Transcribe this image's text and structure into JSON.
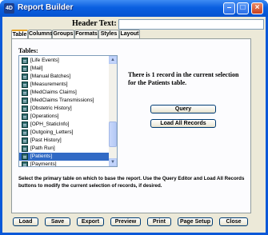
{
  "window": {
    "title": "Report Builder",
    "app_icon_text": "4D"
  },
  "header": {
    "label": "Header Text:",
    "value": ""
  },
  "tabs": [
    {
      "label": "Table",
      "active": true
    },
    {
      "label": "Columns",
      "active": false
    },
    {
      "label": "Groups",
      "active": false
    },
    {
      "label": "Formats",
      "active": false
    },
    {
      "label": "Styles",
      "active": false
    },
    {
      "label": "Layout",
      "active": false
    }
  ],
  "tables": {
    "label": "Tables:",
    "items": [
      {
        "label": "[Life Events]",
        "selected": false
      },
      {
        "label": "[Mail]",
        "selected": false
      },
      {
        "label": "[Manual Batches]",
        "selected": false
      },
      {
        "label": "[Measurements]",
        "selected": false
      },
      {
        "label": "[MedClaims Claims]",
        "selected": false
      },
      {
        "label": "[MedClaims Transmissions]",
        "selected": false
      },
      {
        "label": "[Obstetric History]",
        "selected": false
      },
      {
        "label": "[Operations]",
        "selected": false
      },
      {
        "label": "[OPH_StaticInfo]",
        "selected": false
      },
      {
        "label": "[Outgoing_Letters]",
        "selected": false
      },
      {
        "label": "[Past History]",
        "selected": false
      },
      {
        "label": "[Path Run]",
        "selected": false
      },
      {
        "label": "[Patients]",
        "selected": true
      },
      {
        "label": "[Payments]",
        "selected": false
      }
    ]
  },
  "record_info": "There is 1 record in the current selection for the Patients table.",
  "buttons": {
    "query": "Query",
    "load_all": "Load All Records"
  },
  "help_text": "Select the primary table on which to base the report. Use the Query Editor and Load All Records buttons to modify the current selection of records, if desired.",
  "footer": {
    "load": "Load",
    "save": "Save",
    "export": "Export",
    "preview": "Preview",
    "print": "Print",
    "page_setup": "Page Setup",
    "close": "Close"
  }
}
